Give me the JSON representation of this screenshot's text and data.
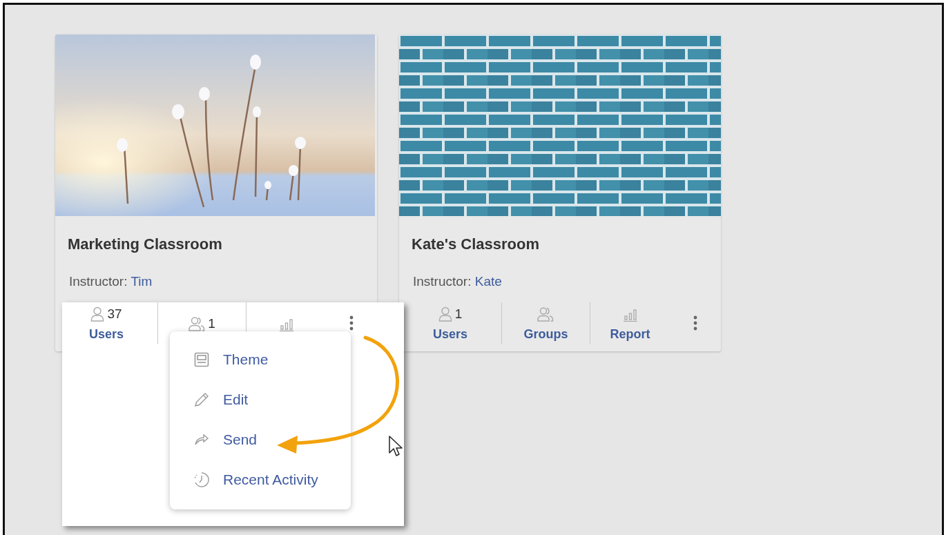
{
  "cards": [
    {
      "title": "Marketing Classroom",
      "photo": {
        "kind": "snowy-plants"
      },
      "instructor_label": "Instructor:",
      "instructor": "Tim",
      "highlighted": true,
      "stats": [
        {
          "kind": "users",
          "count": "37",
          "label": "Users"
        },
        {
          "kind": "groups",
          "count": "1"
        },
        {
          "kind": "report"
        }
      ]
    },
    {
      "title": "Kate's Classroom",
      "photo": {
        "kind": "brick-wall"
      },
      "instructor_label": "Instructor:",
      "instructor": "Kate",
      "highlighted": false,
      "stats": [
        {
          "kind": "users",
          "count": "1",
          "label": "Users"
        },
        {
          "kind": "groups",
          "label": "Groups"
        },
        {
          "kind": "report",
          "label": "Report"
        }
      ]
    }
  ],
  "menu": {
    "items": [
      {
        "kind": "theme",
        "label": "Theme"
      },
      {
        "kind": "edit",
        "label": "Edit"
      },
      {
        "kind": "send",
        "label": "Send"
      },
      {
        "kind": "activity",
        "label": "Recent Activity"
      }
    ]
  }
}
